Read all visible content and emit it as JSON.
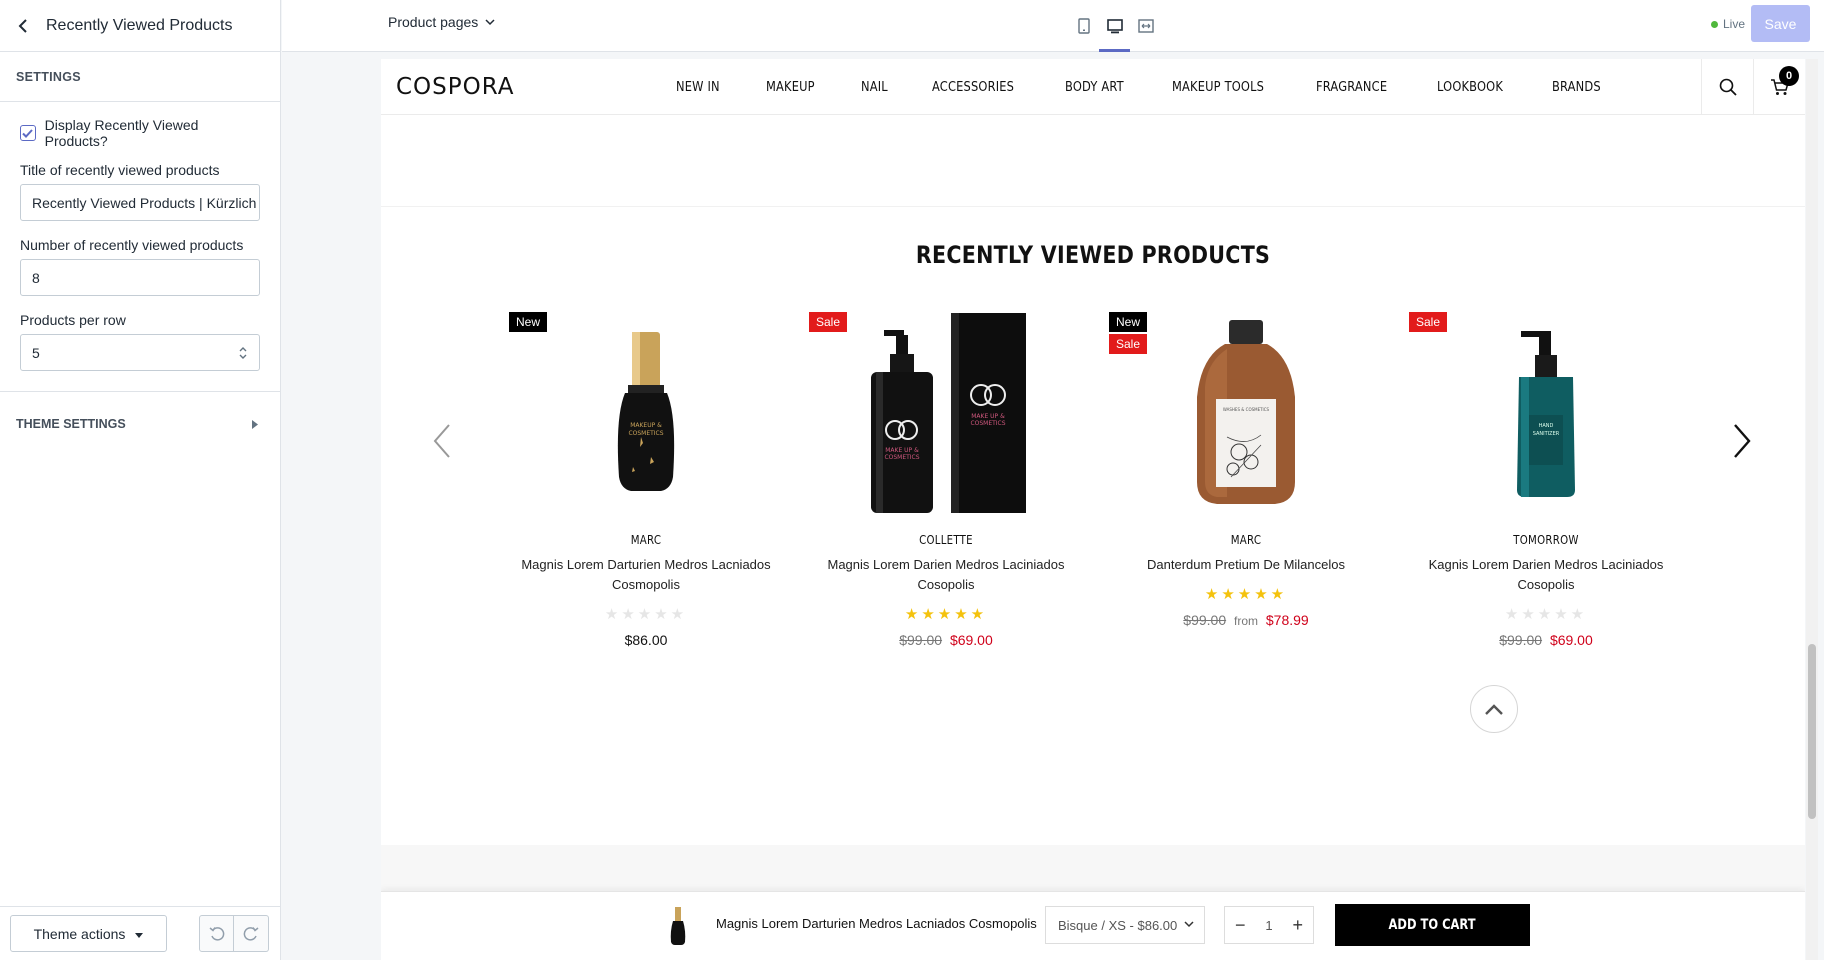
{
  "sidebar": {
    "title": "Recently Viewed Products",
    "section_label": "SETTINGS",
    "display_checkbox_label": "Display Recently Viewed Products?",
    "display_checked": true,
    "title_field_label": "Title of recently viewed products",
    "title_field_value": "Recently Viewed Products | Kürzlich",
    "number_field_label": "Number of recently viewed products",
    "number_field_value": "8",
    "per_row_label": "Products per row",
    "per_row_value": "5",
    "theme_settings_label": "THEME SETTINGS",
    "theme_actions_label": "Theme actions"
  },
  "topbar": {
    "page_select_label": "Product pages",
    "live_label": "Live",
    "save_label": "Save",
    "accent_color": "#5c6ac4"
  },
  "store": {
    "logo": "COSPORA",
    "menu": [
      "NEW IN",
      "MAKEUP",
      "NAIL",
      "ACCESSORIES",
      "BODY ART",
      "MAKEUP TOOLS",
      "FRAGRANCE",
      "LOOKBOOK",
      "BRANDS"
    ],
    "cart_count": "0",
    "section_title": "RECENTLY VIEWED PRODUCTS",
    "products": [
      {
        "badges": [
          "New"
        ],
        "brand": "MARC",
        "name": "Magnis Lorem Darturien Medros Lacniados Cosmopolis",
        "rating": 0,
        "price_old": "",
        "price_prefix": "",
        "price": "$86.00",
        "on_sale": false,
        "image": "black-perfume-bottle"
      },
      {
        "badges": [
          "Sale"
        ],
        "brand": "COLLETTE",
        "name": "Magnis Lorem Darien Medros Laciniados Cosopolis",
        "rating": 5,
        "price_old": "$99.00",
        "price_prefix": "",
        "price": "$69.00",
        "on_sale": true,
        "image": "black-pump-bottle-with-box"
      },
      {
        "badges": [
          "New",
          "Sale"
        ],
        "brand": "MARC",
        "name": "Danterdum Pretium De Milancelos",
        "rating": 5,
        "price_old": "$99.00",
        "price_prefix": "from",
        "price": "$78.99",
        "on_sale": true,
        "image": "amber-bottle"
      },
      {
        "badges": [
          "Sale"
        ],
        "brand": "TOMORROW",
        "name": "Kagnis Lorem Darien Medros Laciniados Cosopolis",
        "rating": 0,
        "price_old": "$99.00",
        "price_prefix": "",
        "price": "$69.00",
        "on_sale": true,
        "image": "teal-sanitizer-pump"
      }
    ],
    "sticky_bar": {
      "product_name": "Magnis Lorem Darturien Medros Lacniados Cosmopolis",
      "variant": "Bisque / XS - $86.00",
      "quantity": "1",
      "add_to_cart": "ADD TO CART"
    },
    "badge_colors": {
      "new": "#000000",
      "sale": "#e21b1b"
    },
    "sale_price_color": "#d0021b",
    "star_color": "#f4c20d"
  }
}
